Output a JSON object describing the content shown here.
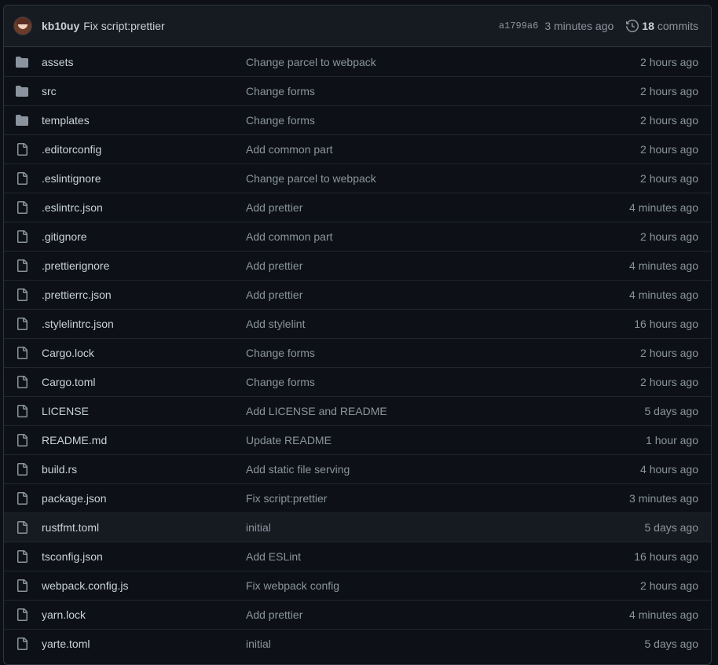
{
  "latest_commit": {
    "author": "kb10uy",
    "message": "Fix script:prettier",
    "sha": "a1799a6",
    "time": "3 minutes ago",
    "commit_count": "18",
    "commit_label": "commits"
  },
  "files": [
    {
      "name": "assets",
      "type": "folder",
      "message": "Change parcel to webpack",
      "age": "2 hours ago"
    },
    {
      "name": "src",
      "type": "folder",
      "message": "Change forms",
      "age": "2 hours ago"
    },
    {
      "name": "templates",
      "type": "folder",
      "message": "Change forms",
      "age": "2 hours ago"
    },
    {
      "name": ".editorconfig",
      "type": "file",
      "message": "Add common part",
      "age": "2 hours ago"
    },
    {
      "name": ".eslintignore",
      "type": "file",
      "message": "Change parcel to webpack",
      "age": "2 hours ago"
    },
    {
      "name": ".eslintrc.json",
      "type": "file",
      "message": "Add prettier",
      "age": "4 minutes ago"
    },
    {
      "name": ".gitignore",
      "type": "file",
      "message": "Add common part",
      "age": "2 hours ago"
    },
    {
      "name": ".prettierignore",
      "type": "file",
      "message": "Add prettier",
      "age": "4 minutes ago"
    },
    {
      "name": ".prettierrc.json",
      "type": "file",
      "message": "Add prettier",
      "age": "4 minutes ago"
    },
    {
      "name": ".stylelintrc.json",
      "type": "file",
      "message": "Add stylelint",
      "age": "16 hours ago"
    },
    {
      "name": "Cargo.lock",
      "type": "file",
      "message": "Change forms",
      "age": "2 hours ago"
    },
    {
      "name": "Cargo.toml",
      "type": "file",
      "message": "Change forms",
      "age": "2 hours ago"
    },
    {
      "name": "LICENSE",
      "type": "file",
      "message": "Add LICENSE and README",
      "age": "5 days ago"
    },
    {
      "name": "README.md",
      "type": "file",
      "message": "Update README",
      "age": "1 hour ago"
    },
    {
      "name": "build.rs",
      "type": "file",
      "message": "Add static file serving",
      "age": "4 hours ago"
    },
    {
      "name": "package.json",
      "type": "file",
      "message": "Fix script:prettier",
      "age": "3 minutes ago"
    },
    {
      "name": "rustfmt.toml",
      "type": "file",
      "message": "initial",
      "age": "5 days ago",
      "hover": true
    },
    {
      "name": "tsconfig.json",
      "type": "file",
      "message": "Add ESLint",
      "age": "16 hours ago"
    },
    {
      "name": "webpack.config.js",
      "type": "file",
      "message": "Fix webpack config",
      "age": "2 hours ago"
    },
    {
      "name": "yarn.lock",
      "type": "file",
      "message": "Add prettier",
      "age": "4 minutes ago"
    },
    {
      "name": "yarte.toml",
      "type": "file",
      "message": "initial",
      "age": "5 days ago"
    }
  ],
  "colors": {
    "background": "#0d1117",
    "header": "#161b22",
    "border": "#30363d",
    "folder_icon": "#8b949e",
    "file_icon": "#8b949e"
  }
}
